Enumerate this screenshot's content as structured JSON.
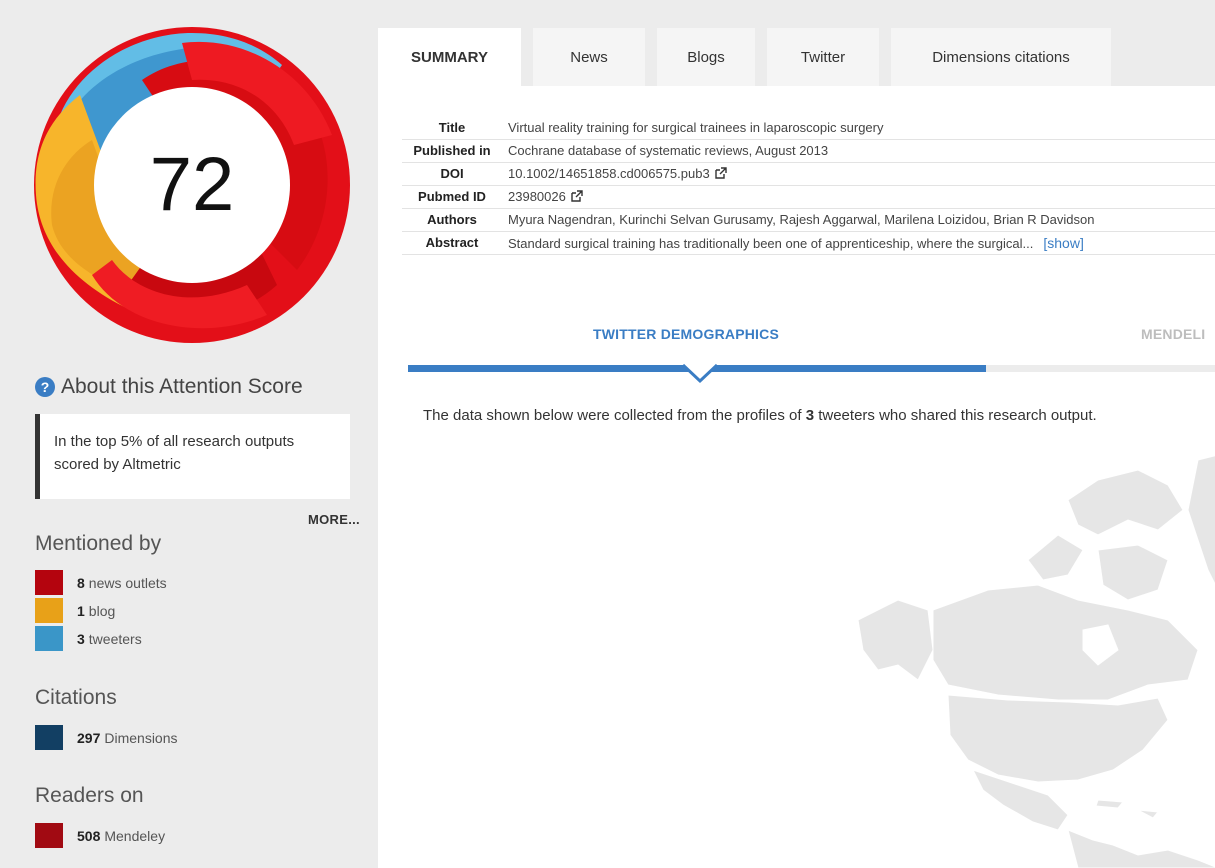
{
  "score": {
    "value": "72",
    "colors": [
      "#e8141c",
      "#f4b33a",
      "#59b8e0"
    ]
  },
  "about": {
    "icon": "help-icon",
    "label": "About this Attention Score",
    "rank_text": "In the top 5% of all research outputs scored by Altmetric",
    "more": "MORE..."
  },
  "mentioned_by": {
    "title": "Mentioned by",
    "items": [
      {
        "count": "8",
        "label": "news outlets",
        "color": "#b4040e"
      },
      {
        "count": "1",
        "label": "blog",
        "color": "#e8a118"
      },
      {
        "count": "3",
        "label": "tweeters",
        "color": "#3a96c8"
      }
    ]
  },
  "citations": {
    "title": "Citations",
    "items": [
      {
        "count": "297",
        "label": "Dimensions",
        "color": "#123f63"
      }
    ]
  },
  "readers": {
    "title": "Readers on",
    "items": [
      {
        "count": "508",
        "label": "Mendeley",
        "color": "#a10a12"
      }
    ]
  },
  "tabs": [
    "SUMMARY",
    "News",
    "Blogs",
    "Twitter",
    "Dimensions citations"
  ],
  "meta": [
    {
      "key": "Title",
      "value": "Virtual reality training for surgical trainees in laparoscopic surgery"
    },
    {
      "key": "Published in",
      "value": "Cochrane database of systematic reviews, August 2013"
    },
    {
      "key": "DOI",
      "value": "10.1002/14651858.cd006575.pub3"
    },
    {
      "key": "Pubmed ID",
      "value": "23980026"
    },
    {
      "key": "Authors",
      "value": "Myura Nagendran, Kurinchi Selvan Gurusamy, Rajesh Aggarwal, Marilena Loizidou, Brian R Davidson"
    },
    {
      "key": "Abstract",
      "value": "Standard surgical training has traditionally been one of apprenticeship, where the surgical...",
      "link": "[show]"
    }
  ],
  "demographics": {
    "tab_active": "TWITTER DEMOGRAPHICS",
    "tab_other": "MENDELI",
    "text_before": "The data shown below were collected from the profiles of ",
    "tweeters": "3",
    "text_after": " tweeters who shared this research output.",
    "accent": "#3a7dc4"
  }
}
